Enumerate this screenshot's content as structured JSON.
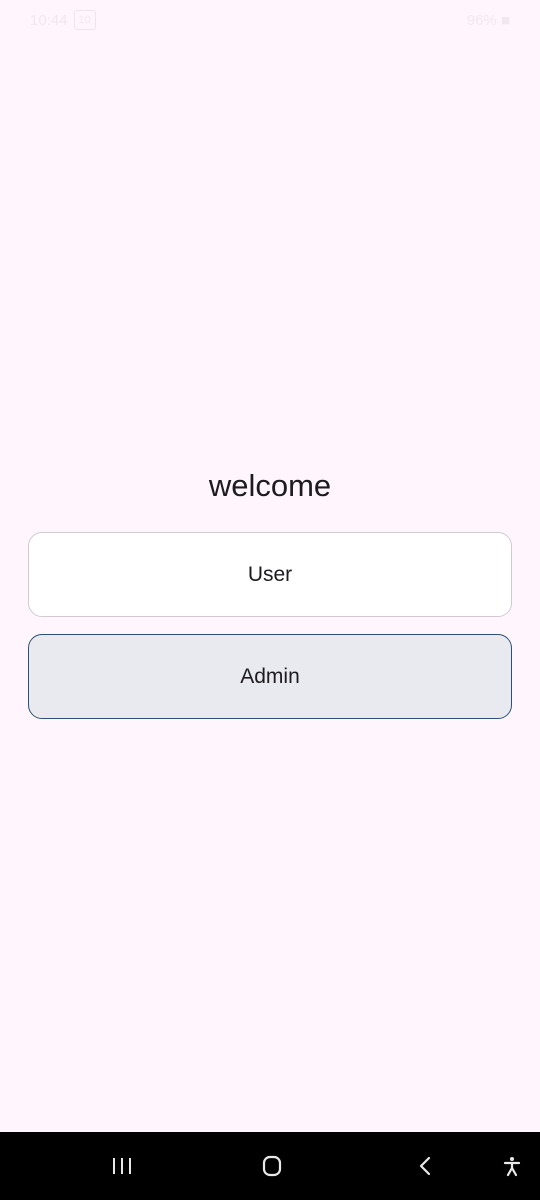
{
  "status_bar": {
    "time": "10:44",
    "chip": "10",
    "right_text": "96% ■"
  },
  "main": {
    "welcome_text": "welcome",
    "buttons": [
      {
        "label": "User"
      },
      {
        "label": "Admin"
      }
    ]
  },
  "icons": {
    "recents": "recents-icon",
    "home": "home-icon",
    "back": "back-icon",
    "accessibility": "accessibility-icon"
  },
  "colors": {
    "background": "#FEF6FC",
    "user_button_bg": "#FFFFFF",
    "admin_button_bg": "#E8EAEF",
    "admin_border": "#2F4F76",
    "nav_bar": "#000000"
  }
}
